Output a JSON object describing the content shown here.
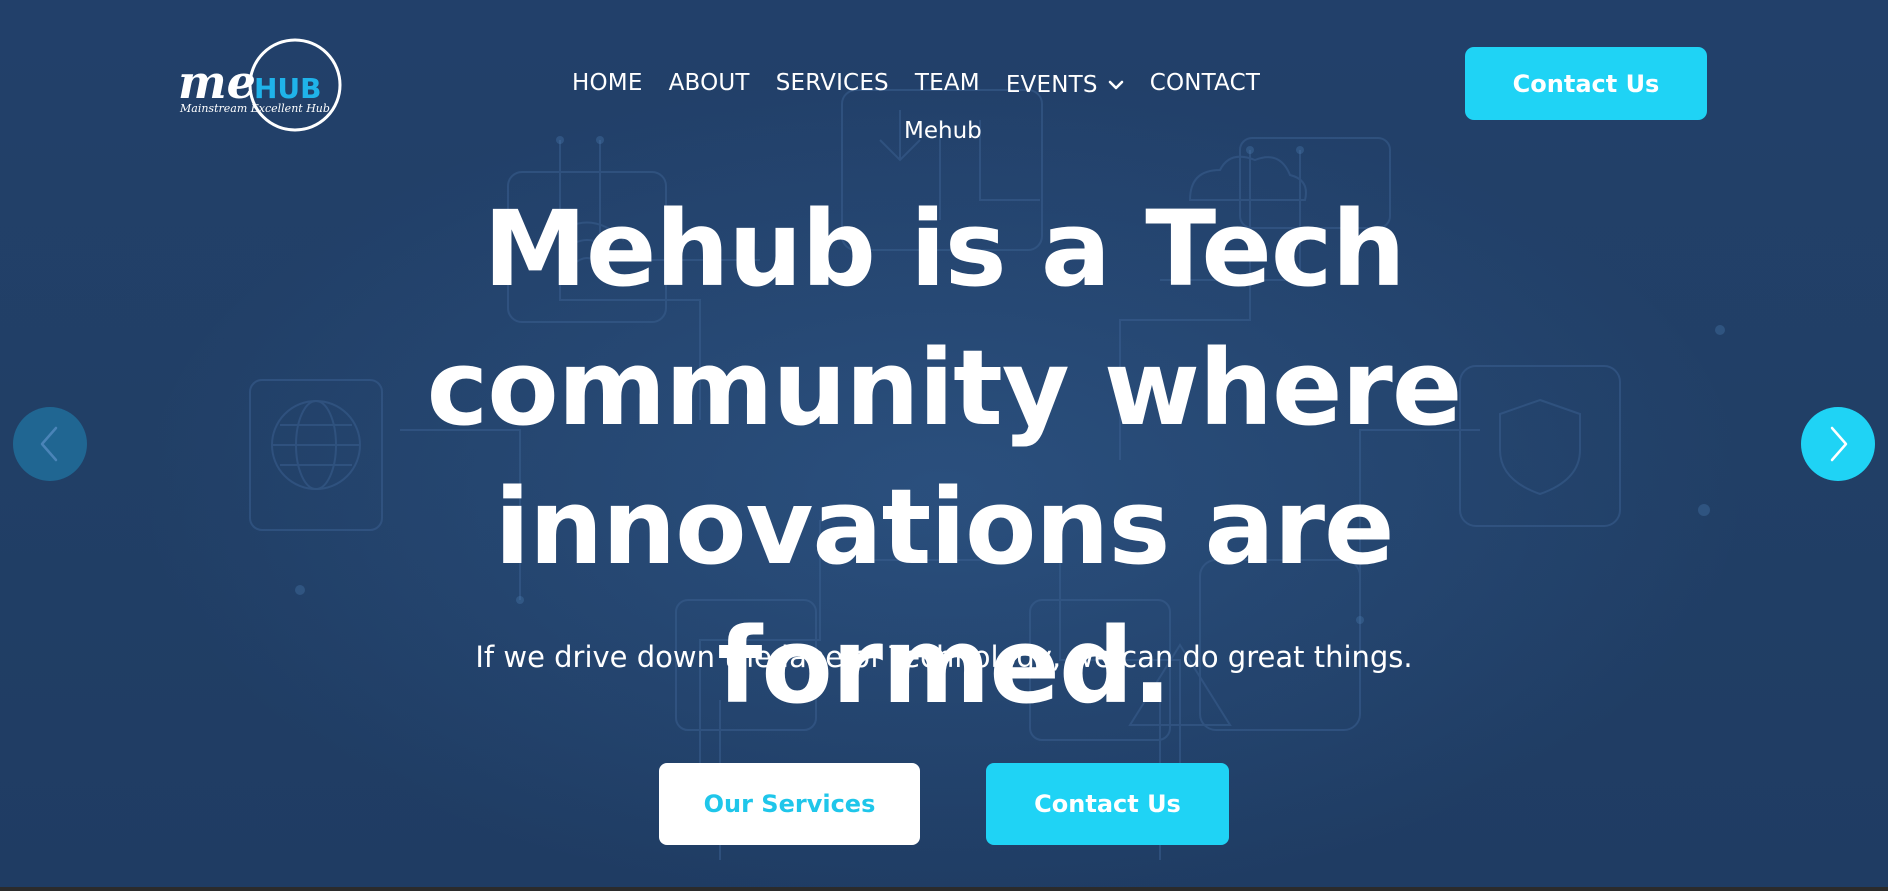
{
  "brand": {
    "logo_text_me": "me",
    "logo_text_hub": "HUB",
    "logo_tagline": "Mainstream Excellent Hub"
  },
  "nav": {
    "items": [
      {
        "label": "HOME"
      },
      {
        "label": "ABOUT"
      },
      {
        "label": "SERVICES"
      },
      {
        "label": "TEAM"
      },
      {
        "label": "EVENTS",
        "has_dropdown": true
      },
      {
        "label": "CONTACT"
      }
    ],
    "sub_label": "Mehub"
  },
  "header": {
    "cta_label": "Contact Us"
  },
  "hero": {
    "headline_lines": [
      "Mehub is a Tech",
      "community where",
      "innovations are formed."
    ],
    "subtext": "If we drive down the lane of Technology, we can do great things.",
    "primary_button": "Our Services",
    "secondary_button": "Contact Us"
  },
  "carousel": {
    "prev_icon": "chevron-left-icon",
    "next_icon": "chevron-right-icon"
  },
  "colors": {
    "background": "#213f66",
    "accent": "#1fd3f5",
    "accent_text": "#1fc6ea",
    "text": "#ffffff"
  }
}
